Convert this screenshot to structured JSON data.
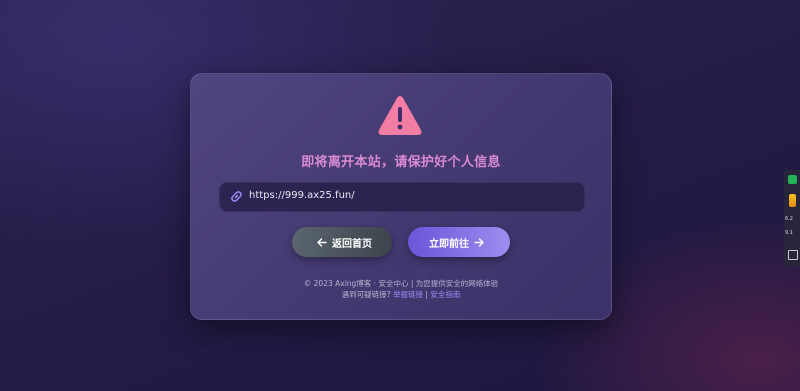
{
  "card": {
    "title": "即将离开本站，请保护好个人信息",
    "icons": {
      "warning": "warning-triangle-icon",
      "link": "link-icon"
    },
    "url": "https://999.ax25.fun/",
    "buttons": {
      "back_label": "返回首页",
      "go_label": "立即前往"
    },
    "footer": {
      "line1": "© 2023 Axing博客 · 安全中心 | 为您提供安全的网络体验",
      "line2_prefix": "遇到可疑链接?",
      "report_link": "举报链接",
      "separator": "|",
      "guide_link": "安全指南"
    }
  },
  "side_widget": {
    "value_1": "6.2",
    "value_2": "9.1"
  },
  "colors": {
    "title": "#d98ad0",
    "warning_icon": "#f47ea3",
    "go_button_start": "#6a55d8",
    "go_button_end": "#9e8df0",
    "back_button_start": "#5a6570",
    "back_button_end": "#3d444c",
    "link": "#9d8cf5"
  }
}
